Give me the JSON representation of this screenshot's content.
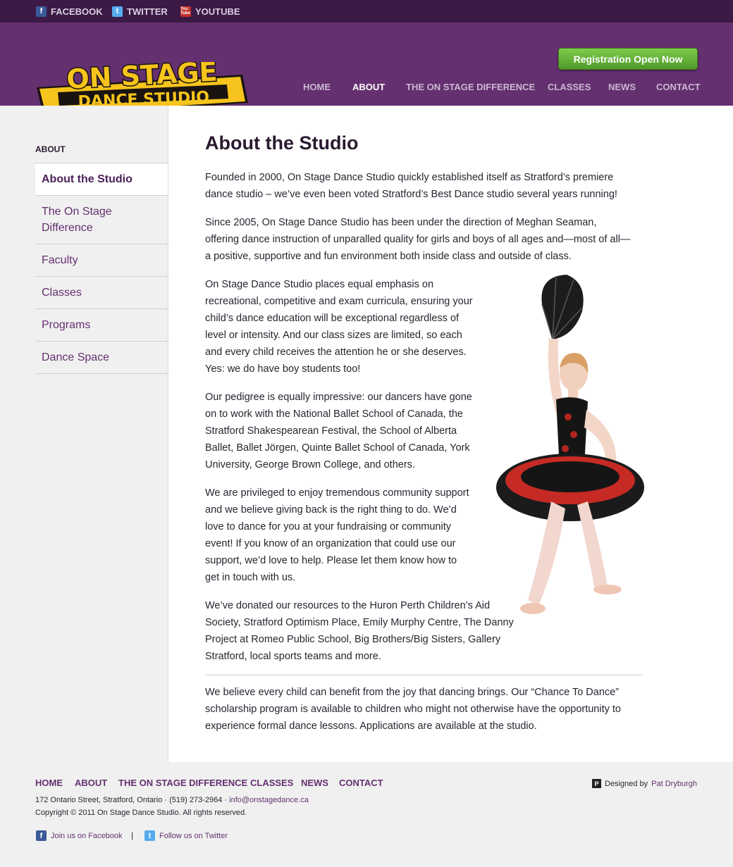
{
  "topbar": {
    "facebook": "FACEBOOK",
    "twitter": "TWITTER",
    "youtube": "YOUTUBE",
    "youtube_icon_text": "You Tube"
  },
  "header": {
    "logo_line1": "ON STAGE",
    "logo_line2": "DANCE STUDIO",
    "registration_button": "Registration Open Now",
    "nav": [
      "HOME",
      "ABOUT",
      "THE ON STAGE DIFFERENCE",
      "CLASSES",
      "NEWS",
      "CONTACT"
    ],
    "nav_active": "ABOUT"
  },
  "sidebar": {
    "heading": "ABOUT",
    "items": [
      {
        "label": "About the Studio",
        "active": true
      },
      {
        "label": "The On Stage Difference",
        "active": false
      },
      {
        "label": "Faculty",
        "active": false
      },
      {
        "label": "Classes",
        "active": false
      },
      {
        "label": "Programs",
        "active": false
      },
      {
        "label": "Dance Space",
        "active": false
      }
    ]
  },
  "main": {
    "title": "About the Studio",
    "paragraphs": [
      "Founded in 2000, On Stage Dance Studio quickly established itself as Stratford’s premiere dance studio – we’ve even been voted Stratford’s Best Dance studio several years running!",
      "Since 2005, On Stage Dance Studio has been under the direction of Meghan Seaman, offering dance instruction of unparalled quality for girls and boys of all ages and—most of all—a positive, supportive and fun environment both inside class and outside of class.",
      "On Stage Dance Studio places equal emphasis on recreational, competitive and exam curricula, ensuring your child’s dance education will be exceptional regardless of level or intensity. And our class sizes are limited, so each and every child receives the attention he or she deserves. Yes: we do have boy students too!",
      "Our pedigree is equally impressive: our dancers have gone on to work with the National Ballet School of Canada, the Stratford Shakespearean Festival, the School of Alberta Ballet, Ballet Jörgen, Quinte Ballet School of Canada, York University, George Brown College, and others.",
      "We are privileged to enjoy tremendous community support and we believe giving back is the right thing to do. We’d love to dance for you at your fundraising or community event! If you know of an organization that could use our support, we’d love to help. Please let them know how to get in touch with us.",
      "We’ve donated our resources to the Huron Perth Children’s Aid Society, Stratford Optimism Place, Emily Murphy Centre, The Danny Project at Romeo Public School, Big Brothers/Big Sisters, Gallery Stratford, local sports teams and more.",
      "We believe every child can benefit from the joy that dancing brings. Our “Chance To Dance” scholarship program is available to children who might not otherwise have the opportunity to experience formal dance lessons. Applications are available at the studio."
    ]
  },
  "footer": {
    "nav": [
      "HOME",
      "ABOUT",
      "THE ON STAGE DIFFERENCE",
      "CLASSES",
      "NEWS",
      "CONTACT"
    ],
    "address": "172 Ontario Street, Stratford, Ontario · (519) 273-2964 · ",
    "email": "info@onstagedance.ca",
    "copyright": "Copyright © 2011 On Stage Dance Studio. All rights reserved.",
    "facebook_link": "Join us on Facebook",
    "separator": "|",
    "twitter_link": "Follow us on Twitter",
    "designed_by": "Designed by",
    "designer": "Pat Dryburgh"
  },
  "colors": {
    "header_purple": "#64306f",
    "topbar_purple": "#3b1a46",
    "accent_green": "#5aa831",
    "logo_yellow": "#f6c41c"
  }
}
